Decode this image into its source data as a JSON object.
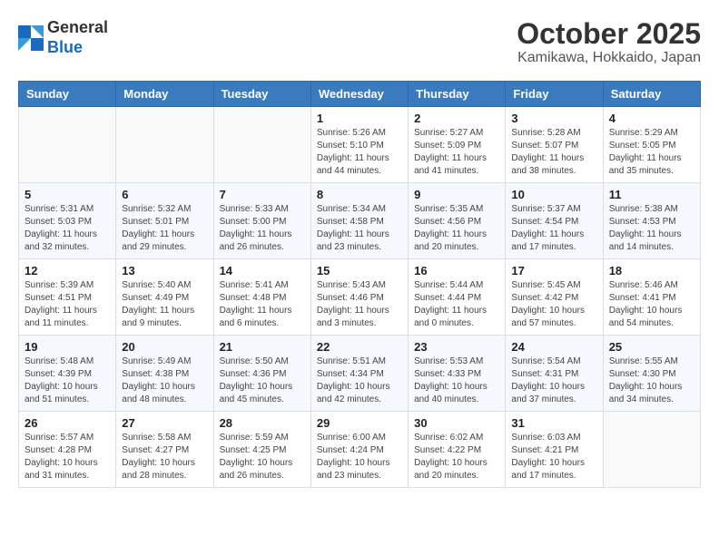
{
  "header": {
    "logo_line1": "General",
    "logo_line2": "Blue",
    "month_title": "October 2025",
    "location": "Kamikawa, Hokkaido, Japan"
  },
  "weekdays": [
    "Sunday",
    "Monday",
    "Tuesday",
    "Wednesday",
    "Thursday",
    "Friday",
    "Saturday"
  ],
  "weeks": [
    [
      {
        "day": "",
        "info": ""
      },
      {
        "day": "",
        "info": ""
      },
      {
        "day": "",
        "info": ""
      },
      {
        "day": "1",
        "info": "Sunrise: 5:26 AM\nSunset: 5:10 PM\nDaylight: 11 hours and 44 minutes."
      },
      {
        "day": "2",
        "info": "Sunrise: 5:27 AM\nSunset: 5:09 PM\nDaylight: 11 hours and 41 minutes."
      },
      {
        "day": "3",
        "info": "Sunrise: 5:28 AM\nSunset: 5:07 PM\nDaylight: 11 hours and 38 minutes."
      },
      {
        "day": "4",
        "info": "Sunrise: 5:29 AM\nSunset: 5:05 PM\nDaylight: 11 hours and 35 minutes."
      }
    ],
    [
      {
        "day": "5",
        "info": "Sunrise: 5:31 AM\nSunset: 5:03 PM\nDaylight: 11 hours and 32 minutes."
      },
      {
        "day": "6",
        "info": "Sunrise: 5:32 AM\nSunset: 5:01 PM\nDaylight: 11 hours and 29 minutes."
      },
      {
        "day": "7",
        "info": "Sunrise: 5:33 AM\nSunset: 5:00 PM\nDaylight: 11 hours and 26 minutes."
      },
      {
        "day": "8",
        "info": "Sunrise: 5:34 AM\nSunset: 4:58 PM\nDaylight: 11 hours and 23 minutes."
      },
      {
        "day": "9",
        "info": "Sunrise: 5:35 AM\nSunset: 4:56 PM\nDaylight: 11 hours and 20 minutes."
      },
      {
        "day": "10",
        "info": "Sunrise: 5:37 AM\nSunset: 4:54 PM\nDaylight: 11 hours and 17 minutes."
      },
      {
        "day": "11",
        "info": "Sunrise: 5:38 AM\nSunset: 4:53 PM\nDaylight: 11 hours and 14 minutes."
      }
    ],
    [
      {
        "day": "12",
        "info": "Sunrise: 5:39 AM\nSunset: 4:51 PM\nDaylight: 11 hours and 11 minutes."
      },
      {
        "day": "13",
        "info": "Sunrise: 5:40 AM\nSunset: 4:49 PM\nDaylight: 11 hours and 9 minutes."
      },
      {
        "day": "14",
        "info": "Sunrise: 5:41 AM\nSunset: 4:48 PM\nDaylight: 11 hours and 6 minutes."
      },
      {
        "day": "15",
        "info": "Sunrise: 5:43 AM\nSunset: 4:46 PM\nDaylight: 11 hours and 3 minutes."
      },
      {
        "day": "16",
        "info": "Sunrise: 5:44 AM\nSunset: 4:44 PM\nDaylight: 11 hours and 0 minutes."
      },
      {
        "day": "17",
        "info": "Sunrise: 5:45 AM\nSunset: 4:42 PM\nDaylight: 10 hours and 57 minutes."
      },
      {
        "day": "18",
        "info": "Sunrise: 5:46 AM\nSunset: 4:41 PM\nDaylight: 10 hours and 54 minutes."
      }
    ],
    [
      {
        "day": "19",
        "info": "Sunrise: 5:48 AM\nSunset: 4:39 PM\nDaylight: 10 hours and 51 minutes."
      },
      {
        "day": "20",
        "info": "Sunrise: 5:49 AM\nSunset: 4:38 PM\nDaylight: 10 hours and 48 minutes."
      },
      {
        "day": "21",
        "info": "Sunrise: 5:50 AM\nSunset: 4:36 PM\nDaylight: 10 hours and 45 minutes."
      },
      {
        "day": "22",
        "info": "Sunrise: 5:51 AM\nSunset: 4:34 PM\nDaylight: 10 hours and 42 minutes."
      },
      {
        "day": "23",
        "info": "Sunrise: 5:53 AM\nSunset: 4:33 PM\nDaylight: 10 hours and 40 minutes."
      },
      {
        "day": "24",
        "info": "Sunrise: 5:54 AM\nSunset: 4:31 PM\nDaylight: 10 hours and 37 minutes."
      },
      {
        "day": "25",
        "info": "Sunrise: 5:55 AM\nSunset: 4:30 PM\nDaylight: 10 hours and 34 minutes."
      }
    ],
    [
      {
        "day": "26",
        "info": "Sunrise: 5:57 AM\nSunset: 4:28 PM\nDaylight: 10 hours and 31 minutes."
      },
      {
        "day": "27",
        "info": "Sunrise: 5:58 AM\nSunset: 4:27 PM\nDaylight: 10 hours and 28 minutes."
      },
      {
        "day": "28",
        "info": "Sunrise: 5:59 AM\nSunset: 4:25 PM\nDaylight: 10 hours and 26 minutes."
      },
      {
        "day": "29",
        "info": "Sunrise: 6:00 AM\nSunset: 4:24 PM\nDaylight: 10 hours and 23 minutes."
      },
      {
        "day": "30",
        "info": "Sunrise: 6:02 AM\nSunset: 4:22 PM\nDaylight: 10 hours and 20 minutes."
      },
      {
        "day": "31",
        "info": "Sunrise: 6:03 AM\nSunset: 4:21 PM\nDaylight: 10 hours and 17 minutes."
      },
      {
        "day": "",
        "info": ""
      }
    ]
  ]
}
